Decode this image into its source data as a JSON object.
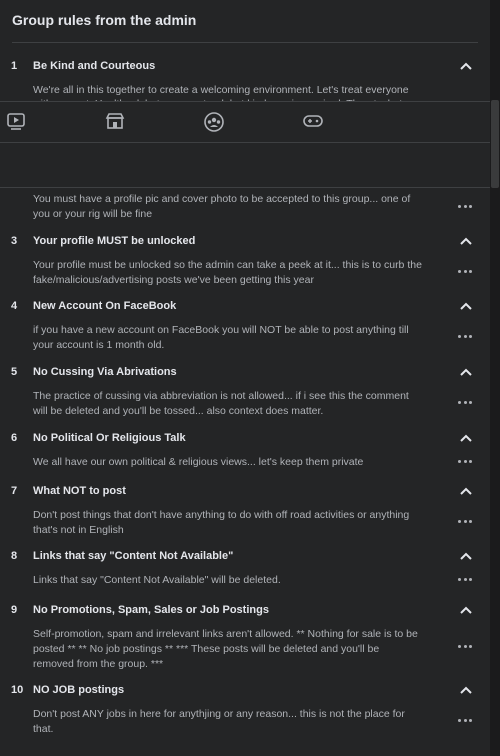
{
  "header": {
    "title": "Group rules from the admin"
  },
  "rule1": {
    "number": "1",
    "title": "Be Kind and Courteous",
    "body_visible": "We're all in this together to create a welcoming environment. Let's treat everyone",
    "body_clipped": "with respect. Healthy debates are natural, but kindness is required. Threats, hate"
  },
  "rule2": {
    "body_line1": "You must have a profile pic and cover photo to be accepted to this group... one of",
    "body_line2": "you or your rig will be fine"
  },
  "rules": [
    {
      "number": "3",
      "title": "Your profile MUST be unlocked",
      "line1": "Your profile must be unlocked so the admin can take a peek at it... this is to curb the",
      "line2": "fake/malicious/advertising posts we've been getting this year",
      "line3": ""
    },
    {
      "number": "4",
      "title": "New Account On FaceBook",
      "line1": "if you have a new account on FaceBook you will NOT be able to post anything till",
      "line2": "your account is 1 month old.",
      "line3": ""
    },
    {
      "number": "5",
      "title": "No Cussing Via Abrivations",
      "line1": "The practice of cussing via abbreviation is not allowed... if i see this the comment",
      "line2": "will be deleted and you'll be tossed... also context does matter.",
      "line3": ""
    },
    {
      "number": "6",
      "title": "No Political Or Religious Talk",
      "line1": "We all have our own political & religious views... let's keep them private",
      "line2": "",
      "line3": ""
    },
    {
      "number": "7",
      "title": "What NOT to post",
      "line1": "Don't post things that don't have anything to do with off road activities or anything",
      "line2": "that's not in English",
      "line3": ""
    },
    {
      "number": "8",
      "title": "Links that say \"Content Not Available\"",
      "line1": "Links that say \"Content Not Available\" will be deleted.",
      "line2": "",
      "line3": ""
    },
    {
      "number": "9",
      "title": "No Promotions, Spam, Sales or Job Postings",
      "line1": "Self-promotion, spam and irrelevant links aren't allowed. ** Nothing for sale is to be",
      "line2": "posted ** ** No job postings ** *** These posts will be deleted and you'll be",
      "line3": "removed from the group. ***"
    },
    {
      "number": "10",
      "title": "NO JOB postings",
      "line1": "Don't post ANY jobs in here for anythjing or any reason... this is not the place for",
      "line2": "that.",
      "line3": ""
    }
  ],
  "nav": {
    "icons": [
      "watch-icon",
      "marketplace-icon",
      "groups-icon",
      "gaming-icon"
    ]
  },
  "colors": {
    "background": "#242526",
    "text": "#e4e6eb",
    "secondary_text": "#b0b3b8",
    "divider": "#3e4042"
  }
}
